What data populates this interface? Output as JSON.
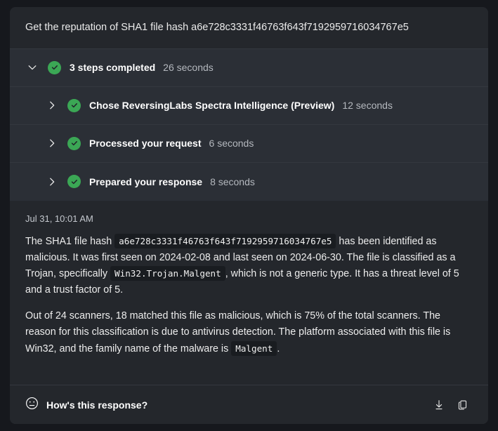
{
  "prompt": {
    "text": "Get the reputation of SHA1 file hash a6e728c3331f46763f643f7192959716034767e5"
  },
  "steps": {
    "summary": {
      "title": "3 steps completed",
      "duration": "26 seconds",
      "expand_icon": "chevron-down-icon",
      "status_icon": "check-circle-icon"
    },
    "items": [
      {
        "title": "Chose ReversingLabs Spectra Intelligence (Preview)",
        "duration": "12 seconds",
        "expand_icon": "chevron-right-icon",
        "status_icon": "check-circle-icon"
      },
      {
        "title": "Processed your request",
        "duration": "6 seconds",
        "expand_icon": "chevron-right-icon",
        "status_icon": "check-circle-icon"
      },
      {
        "title": "Prepared your response",
        "duration": "8 seconds",
        "expand_icon": "chevron-right-icon",
        "status_icon": "check-circle-icon"
      }
    ]
  },
  "answer": {
    "timestamp": "Jul 31, 10:01 AM",
    "paragraph1": {
      "part1": "The SHA1 file hash ",
      "code1": "a6e728c3331f46763f643f7192959716034767e5",
      "part2": " has been identified as malicious. It was first seen on 2024-02-08 and last seen on 2024-06-30. The file is classified as a Trojan, specifically ",
      "code2": "Win32.Trojan.Malgent",
      "part3": ", which is not a generic type. It has a threat level of 5 and a trust factor of 5."
    },
    "paragraph2": {
      "part1": "Out of 24 scanners, 18 matched this file as malicious, which is 75% of the total scanners. The reason for this classification is due to antivirus detection. The platform associated with this file is Win32, and the family name of the malware is ",
      "code1": "Malgent",
      "part2": "."
    }
  },
  "footer": {
    "feedback_label": "How's this response?",
    "feedback_icon": "neutral-face-icon",
    "download_icon": "download-icon",
    "copy_icon": "copy-icon"
  },
  "colors": {
    "success_green": "#3ba755",
    "card_background": "#24272c",
    "steps_background": "#2b2f36",
    "code_background": "#191c20"
  }
}
